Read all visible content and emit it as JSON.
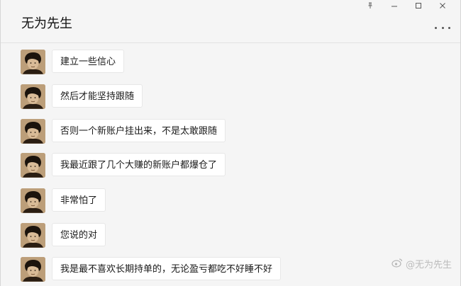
{
  "window": {
    "title": "无为先生",
    "controls": [
      "pin-icon",
      "minimize-icon",
      "maximize-icon",
      "close-icon"
    ],
    "more_icon": "more-icon"
  },
  "messages": [
    {
      "text": "建立一些信心"
    },
    {
      "text": "然后才能坚持跟随"
    },
    {
      "text": "否则一个新账户挂出来，不是太敢跟随"
    },
    {
      "text": "我最近跟了几个大赚的新账户都爆仓了"
    },
    {
      "text": "非常怕了"
    },
    {
      "text": "您说的对"
    },
    {
      "text": "我是最不喜欢长期持单的，无论盈亏都吃不好睡不好"
    }
  ],
  "watermark": {
    "text": "@无为先生"
  },
  "colors": {
    "background": "#f5f5f5",
    "bubble": "#ffffff",
    "bubble_border": "#e7e7e7",
    "text": "#1a1a1a"
  }
}
